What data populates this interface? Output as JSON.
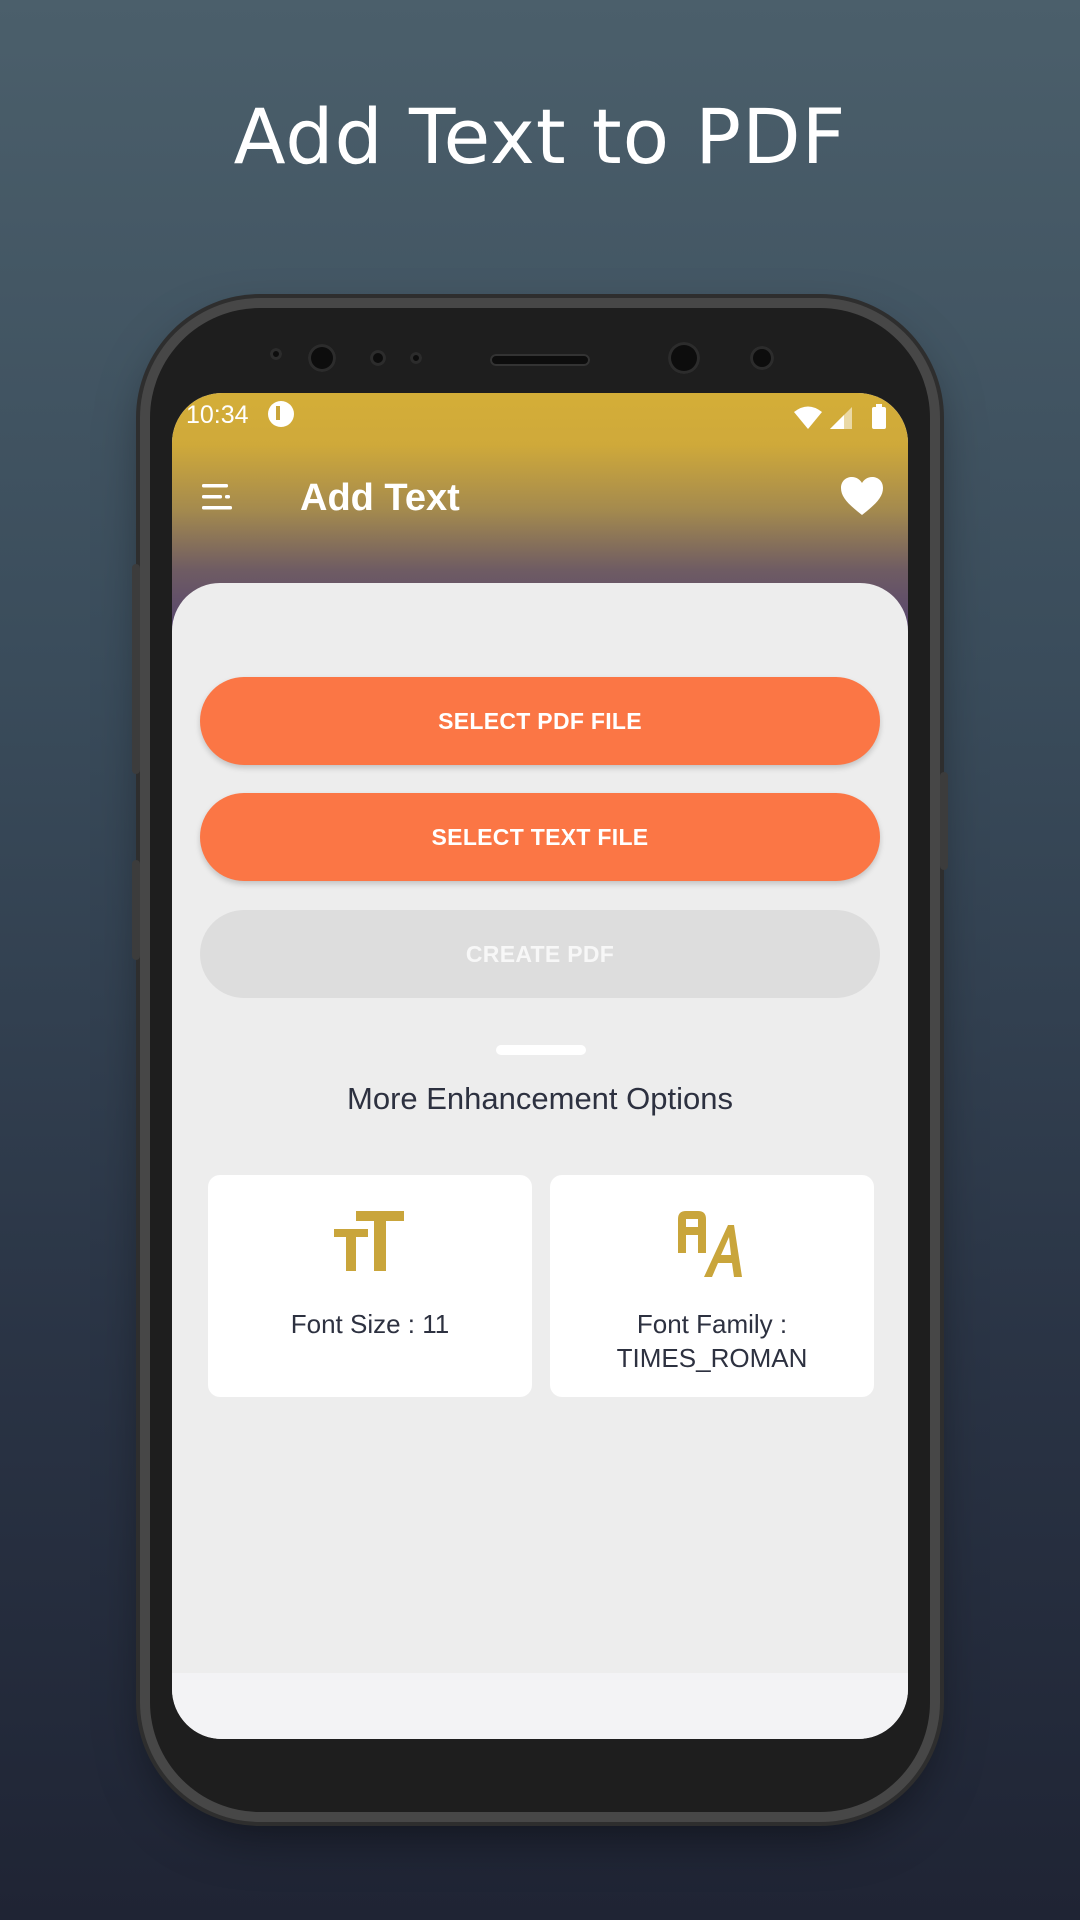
{
  "promo": {
    "headline": "Add Text to PDF"
  },
  "status_bar": {
    "time": "10:34",
    "icons": [
      "app-notification-icon",
      "wifi-icon",
      "signal-icon",
      "battery-icon"
    ]
  },
  "app_bar": {
    "title": "Add Text",
    "menu_icon": "menu-icon",
    "favorite_icon": "heart-icon"
  },
  "actions": {
    "select_pdf": "SELECT PDF FILE",
    "select_text": "SELECT TEXT FILE",
    "create_pdf": "CREATE PDF"
  },
  "enhancements": {
    "title": "More Enhancement Options",
    "options": [
      {
        "icon": "font-size-icon",
        "label": "Font Size : 11"
      },
      {
        "icon": "font-family-icon",
        "label": "Font Family :\nTIMES_ROMAN"
      }
    ]
  },
  "colors": {
    "accent": "#fb7645",
    "icon_gold": "#c9a53b",
    "header_top": "#d4ae38",
    "header_bottom": "#4d3d73",
    "disabled": "#dddddd"
  }
}
